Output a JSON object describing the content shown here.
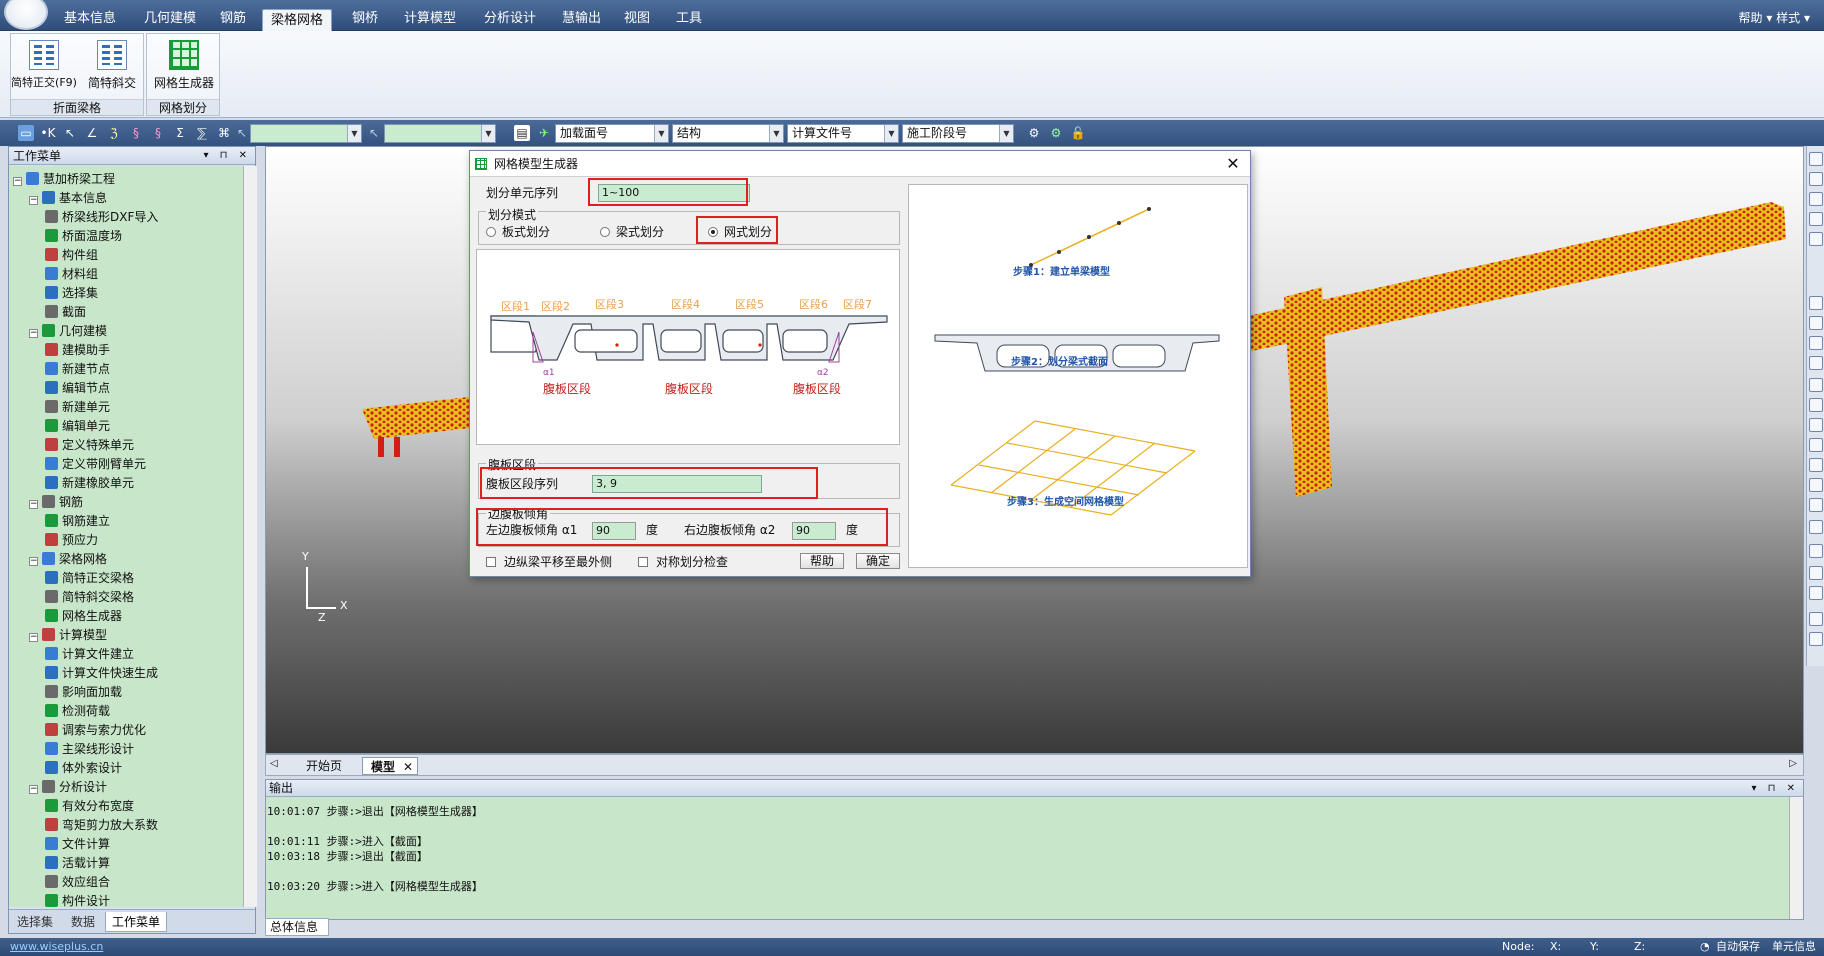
{
  "menubar": {
    "tabs": [
      "基本信息",
      "几何建模",
      "钢筋",
      "梁格网格",
      "钢桥",
      "计算模型",
      "分析设计",
      "慧输出",
      "视图",
      "工具"
    ],
    "active_tab": "梁格网格",
    "right": "帮助 ▾ 样式 ▾"
  },
  "ribbon": {
    "groups": [
      {
        "label": "折面梁格",
        "buttons": [
          "简特正交(F9)",
          "简特斜交"
        ]
      },
      {
        "label": "网格划分",
        "buttons": [
          "网格生成器"
        ]
      }
    ]
  },
  "toolbar": {
    "combo_load": "加载面号",
    "combo_struct": "结构",
    "combo_calc": "计算文件号",
    "combo_stage": "施工阶段号"
  },
  "left_panel": {
    "title": "工作菜单",
    "tree": [
      {
        "level": 0,
        "label": "慧加桥梁工程",
        "exp": "−"
      },
      {
        "level": 1,
        "label": "基本信息",
        "exp": "−"
      },
      {
        "level": 2,
        "label": "桥梁线形DXF导入"
      },
      {
        "level": 2,
        "label": "桥面温度场"
      },
      {
        "level": 2,
        "label": "构件组"
      },
      {
        "level": 2,
        "label": "材料组"
      },
      {
        "level": 2,
        "label": "选择集"
      },
      {
        "level": 2,
        "label": "截面"
      },
      {
        "level": 1,
        "label": "几何建模",
        "exp": "−"
      },
      {
        "level": 2,
        "label": "建模助手"
      },
      {
        "level": 2,
        "label": "新建节点"
      },
      {
        "level": 2,
        "label": "编辑节点"
      },
      {
        "level": 2,
        "label": "新建单元"
      },
      {
        "level": 2,
        "label": "编辑单元"
      },
      {
        "level": 2,
        "label": "定义特殊单元"
      },
      {
        "level": 2,
        "label": "定义带刚臂单元"
      },
      {
        "level": 2,
        "label": "新建橡胶单元"
      },
      {
        "level": 1,
        "label": "钢筋",
        "exp": "−"
      },
      {
        "level": 2,
        "label": "钢筋建立"
      },
      {
        "level": 2,
        "label": "预应力"
      },
      {
        "level": 1,
        "label": "梁格网格",
        "exp": "−"
      },
      {
        "level": 2,
        "label": "简特正交梁格"
      },
      {
        "level": 2,
        "label": "简特斜交梁格"
      },
      {
        "level": 2,
        "label": "网格生成器"
      },
      {
        "level": 1,
        "label": "计算模型",
        "exp": "−"
      },
      {
        "level": 2,
        "label": "计算文件建立"
      },
      {
        "level": 2,
        "label": "计算文件快速生成"
      },
      {
        "level": 2,
        "label": "影响面加载"
      },
      {
        "level": 2,
        "label": "检测荷载"
      },
      {
        "level": 2,
        "label": "调索与索力优化"
      },
      {
        "level": 2,
        "label": "主梁线形设计"
      },
      {
        "level": 2,
        "label": "体外索设计"
      },
      {
        "level": 1,
        "label": "分析设计",
        "exp": "−"
      },
      {
        "level": 2,
        "label": "有效分布宽度"
      },
      {
        "level": 2,
        "label": "弯矩剪力放大系数"
      },
      {
        "level": 2,
        "label": "文件计算"
      },
      {
        "level": 2,
        "label": "活载计算"
      },
      {
        "level": 2,
        "label": "效应组合"
      },
      {
        "level": 2,
        "label": "构件设计"
      }
    ],
    "tabs": [
      "选择集",
      "数据",
      "工作菜单"
    ],
    "active_tab": "工作菜单"
  },
  "viewport": {
    "tabs": [
      "开始页",
      "模型"
    ],
    "active_tab": "模型",
    "axis_y": "Y",
    "axis_x": "X",
    "axis_z": "Z"
  },
  "dialog": {
    "title": "网格模型生成器",
    "seq_label": "划分单元序列",
    "seq_value": "1~100",
    "mode_label": "划分模式",
    "modes": [
      "板式划分",
      "梁式划分",
      "网式划分"
    ],
    "selected_mode": "网式划分",
    "zones": [
      "区段1",
      "区段2",
      "区段3",
      "区段4",
      "区段5",
      "区段6",
      "区段7"
    ],
    "web_label": "腹板区段",
    "angle_a1": "α1",
    "angle_a2": "α2",
    "web_group": "腹板区段",
    "web_seq_label": "腹板区段序列",
    "web_seq_value": "3, 9",
    "edge_group": "边腹板倾角",
    "left_angle_label": "左边腹板倾角 α1",
    "left_angle_value": "90",
    "right_angle_label": "右边腹板倾角 α2",
    "right_angle_value": "90",
    "unit": "度",
    "chk_move": "边纵梁平移至最外侧",
    "chk_sym": "对称划分检查",
    "help_btn": "帮助",
    "ok_btn": "确定",
    "step1": "步骤1：建立单梁模型",
    "step2": "步骤2：划分梁式截面",
    "step3": "步骤3：生成空间网格模型"
  },
  "output": {
    "title": "输出",
    "lines": [
      "10:01:07 步骤:>退出【网格模型生成器】",
      "",
      "10:01:11 步骤:>进入【截面】",
      "10:03:18 步骤:>退出【截面】",
      "",
      "10:03:20 步骤:>进入【网格模型生成器】"
    ],
    "tab": "总体信息"
  },
  "statusbar": {
    "url": "www.wiseplus.cn",
    "node": "Node:",
    "x": "X:",
    "y": "Y:",
    "z": "Z:",
    "autosave": "自动保存",
    "unit_info": "单元信息"
  },
  "colors": {
    "accent": "#2f4d7a",
    "tree_bg": "#c8e6c9",
    "highlight_red": "#e02020",
    "model_yellow": "#f0d020",
    "model_red": "#d02010"
  }
}
